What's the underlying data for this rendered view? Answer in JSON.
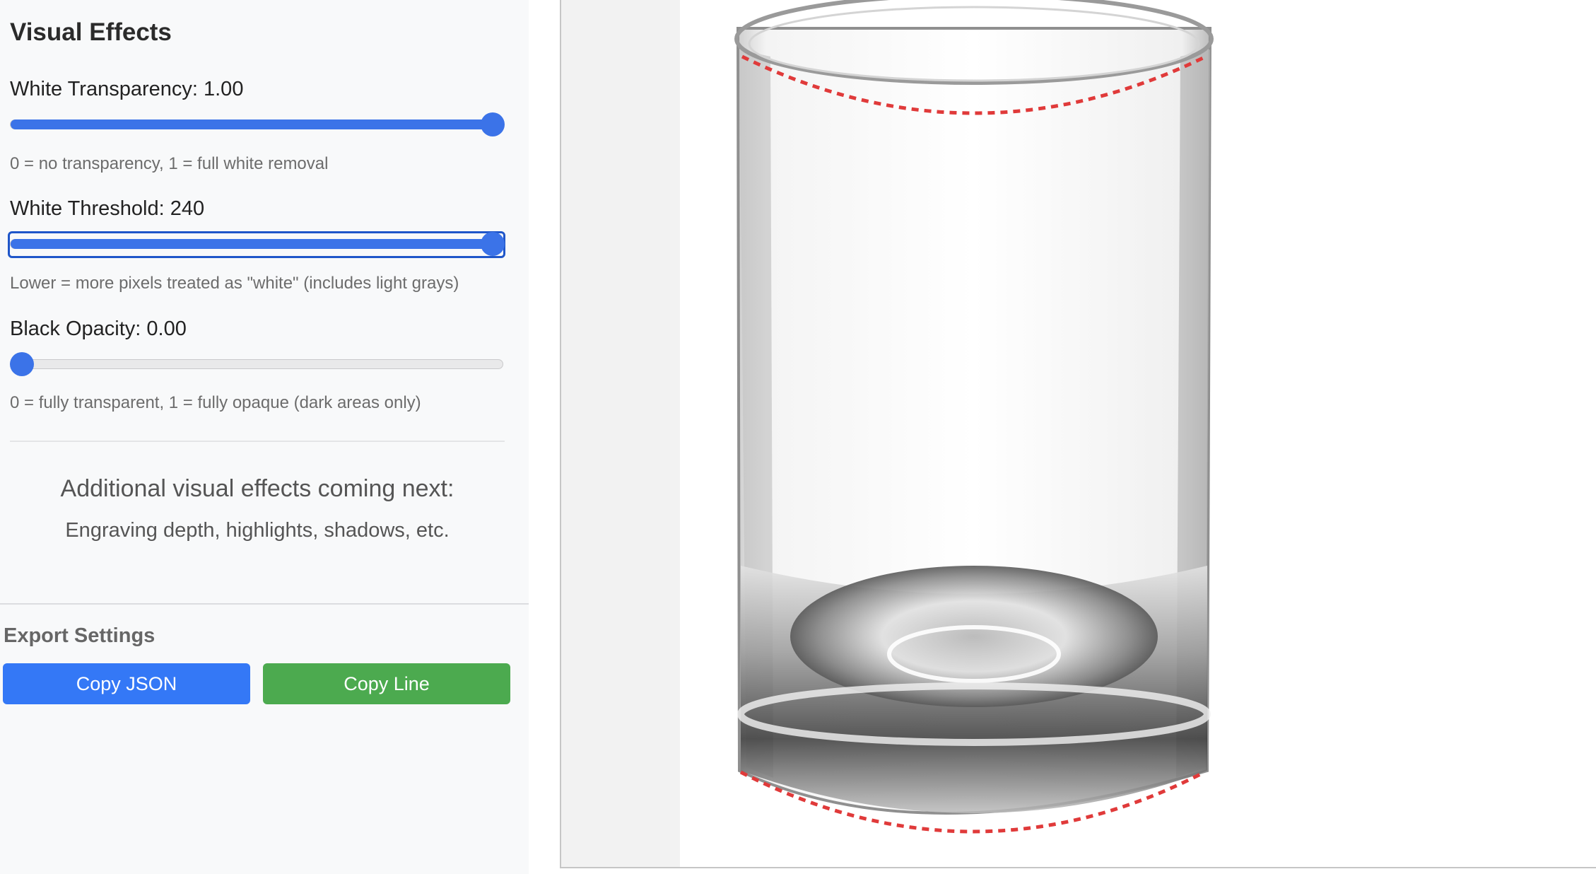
{
  "visual_effects": {
    "title": "Visual Effects",
    "white_transparency": {
      "label": "White Transparency: 1.00",
      "value": 1.0,
      "min": 0,
      "max": 1,
      "hint": "0 = no transparency, 1 = full white removal"
    },
    "white_threshold": {
      "label": "White Threshold: 240",
      "value": 240,
      "hint": "Lower = more pixels treated as \"white\" (includes light grays)"
    },
    "black_opacity": {
      "label": "Black Opacity: 0.00",
      "value": 0.0,
      "min": 0,
      "max": 1,
      "hint": "0 = fully transparent, 1 = fully opaque (dark areas only)"
    },
    "coming_next": {
      "title": "Additional visual effects coming next:",
      "subtitle": "Engraving depth, highlights, shadows, etc."
    }
  },
  "export_settings": {
    "title": "Export Settings",
    "copy_json_label": "Copy JSON",
    "copy_line_label": "Copy Line"
  },
  "colors": {
    "accent_blue": "#3b73e8",
    "button_blue": "#3478f6",
    "button_green": "#4caa4f",
    "guide_line_red": "#e03a3a"
  },
  "canvas": {
    "subject": "glass-tumbler",
    "overlay": "red-dashed-guide-curves"
  }
}
